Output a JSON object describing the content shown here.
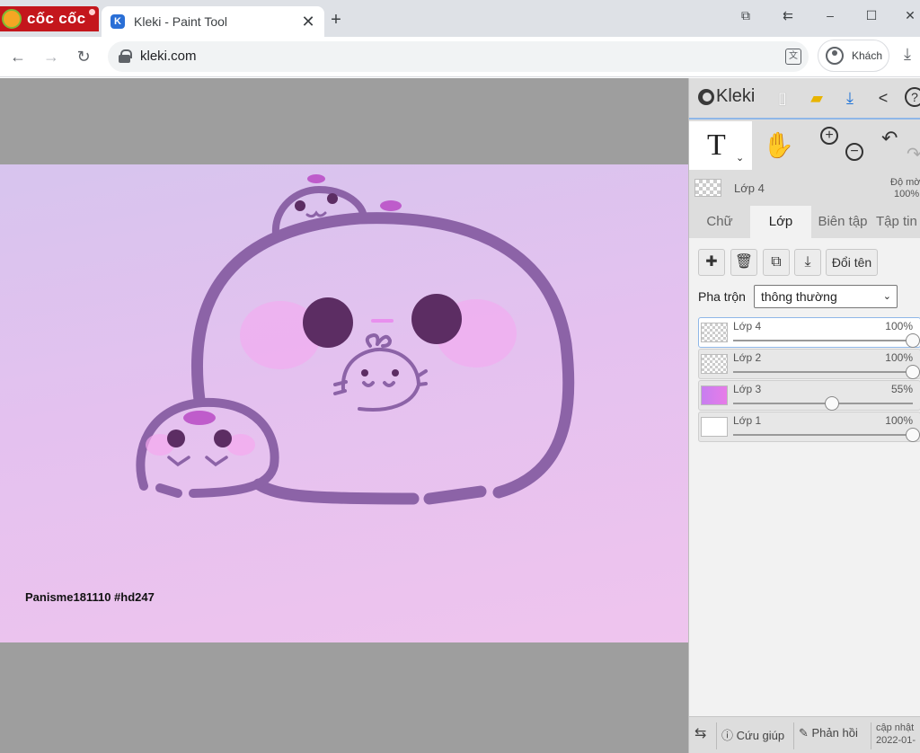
{
  "browser": {
    "brand_name": "cốc cốc",
    "tab_title": "Kleki - Paint Tool",
    "tab_favicon": "K",
    "url": "kleki.com",
    "profile_name": "Khách"
  },
  "kleki": {
    "app_name": "Kleki",
    "current_layer": {
      "name": "Lớp 4",
      "opacity_label": "Độ mờ",
      "opacity": "100%"
    },
    "tabs": [
      "Chữ",
      "Lớp",
      "Biên tập",
      "Tập tin"
    ],
    "active_tab": "Lớp",
    "rename_label": "Đổi tên",
    "blend_label": "Pha trộn",
    "blend_value": "thông thường",
    "layers": [
      {
        "name": "Lớp 4",
        "opacity": "100%",
        "level": 1.0,
        "selected": true
      },
      {
        "name": "Lớp 2",
        "opacity": "100%",
        "level": 1.0,
        "selected": false
      },
      {
        "name": "Lớp 3",
        "opacity": "55%",
        "level": 0.55,
        "selected": false
      },
      {
        "name": "Lớp 1",
        "opacity": "100%",
        "level": 1.0,
        "selected": false
      }
    ],
    "bottom": {
      "help": "Cứu giúp",
      "feedback": "Phản hồi",
      "update_label": "cập nhật",
      "update_date": "2022-01-"
    }
  },
  "canvas": {
    "signature": "Panisme181110 #hd247"
  },
  "colors": {
    "brand_red": "#c4161c",
    "accent_blue": "#2a6fd6",
    "seal_stroke": "#8c63a7",
    "cheek_pink": "#f5a8f0",
    "eye_dark": "#5c2d63"
  }
}
